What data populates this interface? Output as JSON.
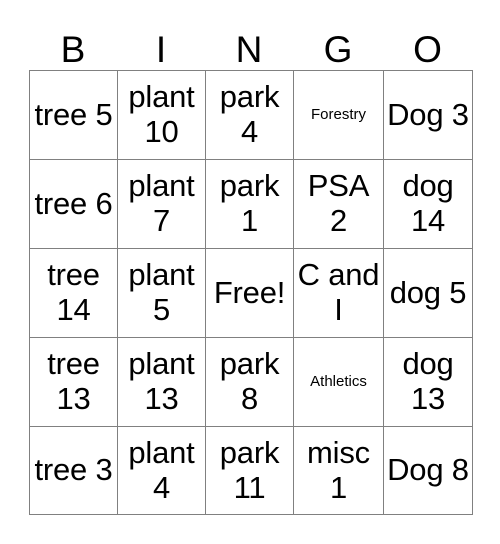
{
  "card": {
    "headers": [
      "B",
      "I",
      "N",
      "G",
      "O"
    ],
    "free_space_label": "Free!",
    "colors": {
      "border": "#808080",
      "text": "#000000",
      "background": "#ffffff"
    },
    "rows": [
      [
        {
          "text": "tree 5",
          "size": "large"
        },
        {
          "text": "plant 10",
          "size": "large"
        },
        {
          "text": "park 4",
          "size": "large"
        },
        {
          "text": "Forestry",
          "size": "small"
        },
        {
          "text": "Dog 3",
          "size": "large"
        }
      ],
      [
        {
          "text": "tree 6",
          "size": "large"
        },
        {
          "text": "plant 7",
          "size": "large"
        },
        {
          "text": "park 1",
          "size": "large"
        },
        {
          "text": "PSA 2",
          "size": "large"
        },
        {
          "text": "dog 14",
          "size": "large"
        }
      ],
      [
        {
          "text": "tree 14",
          "size": "large"
        },
        {
          "text": "plant 5",
          "size": "large"
        },
        {
          "text": "Free!",
          "size": "large"
        },
        {
          "text": "C and I",
          "size": "large"
        },
        {
          "text": "dog 5",
          "size": "large"
        }
      ],
      [
        {
          "text": "tree 13",
          "size": "large"
        },
        {
          "text": "plant 13",
          "size": "large"
        },
        {
          "text": "park 8",
          "size": "large"
        },
        {
          "text": "Athletics",
          "size": "small"
        },
        {
          "text": "dog 13",
          "size": "large"
        }
      ],
      [
        {
          "text": "tree 3",
          "size": "large"
        },
        {
          "text": "plant 4",
          "size": "large"
        },
        {
          "text": "park 11",
          "size": "large"
        },
        {
          "text": "misc 1",
          "size": "large"
        },
        {
          "text": "Dog 8",
          "size": "large"
        }
      ]
    ]
  }
}
